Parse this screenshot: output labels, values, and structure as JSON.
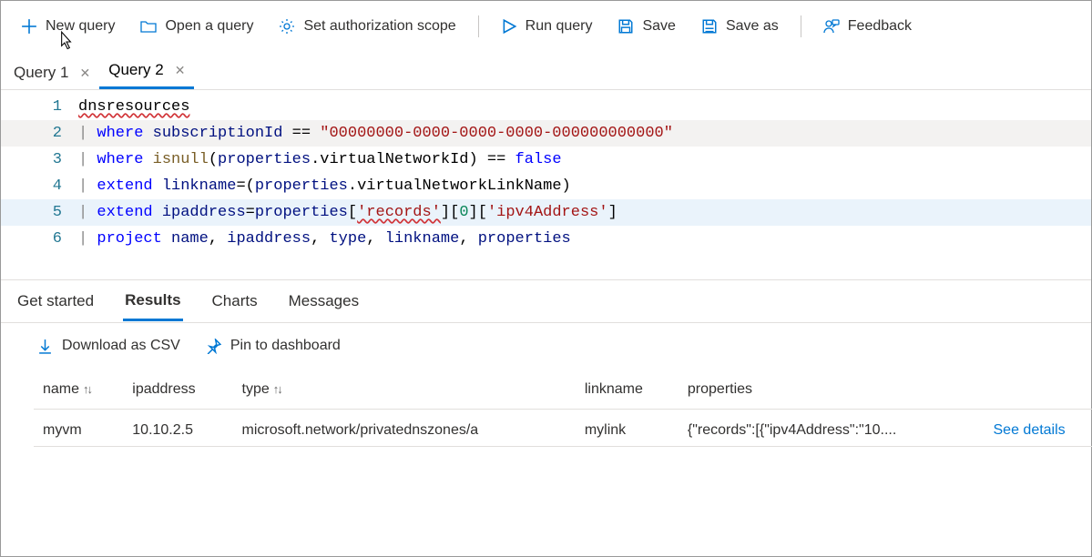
{
  "toolbar": {
    "new_query": "New query",
    "open_query": "Open a query",
    "set_scope": "Set authorization scope",
    "run_query": "Run query",
    "save": "Save",
    "save_as": "Save as",
    "feedback": "Feedback"
  },
  "query_tabs": [
    {
      "label": "Query 1",
      "active": false
    },
    {
      "label": "Query 2",
      "active": true
    }
  ],
  "editor": {
    "lines": [
      {
        "n": 1,
        "tokens": [
          {
            "t": "dnsresources",
            "c": "tok-ident tok-err"
          }
        ]
      },
      {
        "n": 2,
        "hl": "hl2",
        "tokens": [
          {
            "t": "| ",
            "c": "tok-pipe"
          },
          {
            "t": "where",
            "c": "tok-kw"
          },
          {
            "t": " ",
            "c": ""
          },
          {
            "t": "subscriptionId",
            "c": "tok-prop"
          },
          {
            "t": " == ",
            "c": "tok-op"
          },
          {
            "t": "\"00000000-0000-0000-0000-000000000000\"",
            "c": "tok-str"
          }
        ]
      },
      {
        "n": 3,
        "tokens": [
          {
            "t": "| ",
            "c": "tok-pipe"
          },
          {
            "t": "where",
            "c": "tok-kw"
          },
          {
            "t": " ",
            "c": ""
          },
          {
            "t": "isnull",
            "c": "tok-fn"
          },
          {
            "t": "(",
            "c": "tok-op"
          },
          {
            "t": "properties",
            "c": "tok-prop"
          },
          {
            "t": ".",
            "c": "tok-op"
          },
          {
            "t": "virtualNetworkId",
            "c": "tok-ident"
          },
          {
            "t": ") == ",
            "c": "tok-op"
          },
          {
            "t": "false",
            "c": "tok-kw"
          }
        ]
      },
      {
        "n": 4,
        "tokens": [
          {
            "t": "| ",
            "c": "tok-pipe"
          },
          {
            "t": "extend",
            "c": "tok-kw"
          },
          {
            "t": " ",
            "c": ""
          },
          {
            "t": "linkname",
            "c": "tok-prop"
          },
          {
            "t": "=(",
            "c": "tok-op"
          },
          {
            "t": "properties",
            "c": "tok-prop"
          },
          {
            "t": ".",
            "c": "tok-op"
          },
          {
            "t": "virtualNetworkLinkName",
            "c": "tok-ident"
          },
          {
            "t": ")",
            "c": "tok-op"
          }
        ]
      },
      {
        "n": 5,
        "hl": "hl5",
        "tokens": [
          {
            "t": "| ",
            "c": "tok-pipe"
          },
          {
            "t": "extend",
            "c": "tok-kw"
          },
          {
            "t": " ",
            "c": ""
          },
          {
            "t": "ipaddress",
            "c": "tok-prop"
          },
          {
            "t": "=",
            "c": "tok-op"
          },
          {
            "t": "properties",
            "c": "tok-prop"
          },
          {
            "t": "[",
            "c": "tok-op"
          },
          {
            "t": "'records'",
            "c": "tok-str tok-err"
          },
          {
            "t": "][",
            "c": "tok-op"
          },
          {
            "t": "0",
            "c": "tok-num"
          },
          {
            "t": "][",
            "c": "tok-op"
          },
          {
            "t": "'ipv4Address'",
            "c": "tok-str"
          },
          {
            "t": "]",
            "c": "tok-op"
          }
        ]
      },
      {
        "n": 6,
        "tokens": [
          {
            "t": "| ",
            "c": "tok-pipe"
          },
          {
            "t": "project",
            "c": "tok-kw"
          },
          {
            "t": " ",
            "c": ""
          },
          {
            "t": "name",
            "c": "tok-prop"
          },
          {
            "t": ", ",
            "c": "tok-op"
          },
          {
            "t": "ipaddress",
            "c": "tok-prop"
          },
          {
            "t": ", ",
            "c": "tok-op"
          },
          {
            "t": "type",
            "c": "tok-prop"
          },
          {
            "t": ", ",
            "c": "tok-op"
          },
          {
            "t": "linkname",
            "c": "tok-prop"
          },
          {
            "t": ", ",
            "c": "tok-op"
          },
          {
            "t": "properties",
            "c": "tok-prop"
          }
        ]
      }
    ]
  },
  "result_tabs": {
    "get_started": "Get started",
    "results": "Results",
    "charts": "Charts",
    "messages": "Messages"
  },
  "result_actions": {
    "download": "Download as CSV",
    "pin": "Pin to dashboard"
  },
  "table": {
    "headers": [
      "name",
      "ipaddress",
      "type",
      "linkname",
      "properties"
    ],
    "sortable": [
      true,
      false,
      true,
      false,
      false
    ],
    "rows": [
      {
        "name": "myvm",
        "ipaddress": "10.10.2.5",
        "type": "microsoft.network/privatednszones/a",
        "linkname": "mylink",
        "properties": "{\"records\":[{\"ipv4Address\":\"10....",
        "see_details": "See details"
      }
    ]
  },
  "colors": {
    "accent": "#0078d4"
  }
}
